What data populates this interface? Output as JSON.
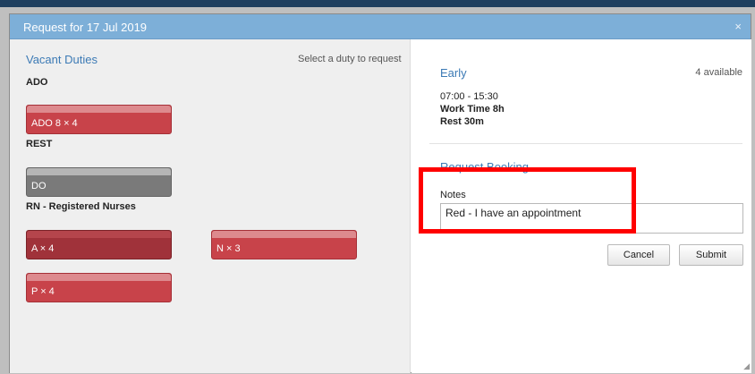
{
  "modal": {
    "title": "Request for 17 Jul 2019",
    "close_label": "×"
  },
  "vacant": {
    "title": "Vacant Duties",
    "hint": "Select a duty to request",
    "groups": [
      {
        "label": "ADO",
        "duties": [
          {
            "label": "ADO 8 × 4",
            "color": "#c8434a"
          }
        ]
      },
      {
        "label": "REST",
        "duties": [
          {
            "label": "DO",
            "color": "#7a7a7a"
          }
        ]
      },
      {
        "label": "RN - Registered Nurses",
        "duties": [
          {
            "label": "A × 4",
            "color": "#a0323a",
            "selected": true
          },
          {
            "label": "N × 3",
            "color": "#c8434a"
          },
          {
            "label": "P × 4",
            "color": "#c8434a"
          }
        ]
      }
    ]
  },
  "detail": {
    "shift_name": "Early",
    "available": "4 available",
    "time": "07:00 - 15:30",
    "work_time": "Work Time 8h",
    "rest": "Rest 30m"
  },
  "booking": {
    "title": "Request Booking",
    "notes_label": "Notes",
    "notes_value": "Red - I have an appointment",
    "cancel_label": "Cancel",
    "submit_label": "Submit"
  },
  "colors": {
    "header": "#7dafd8",
    "accent_text": "#3c7ab5",
    "duty_red": "#c8434a",
    "duty_selected": "#a0323a",
    "duty_grey": "#7a7a7a",
    "highlight": "#ff0000"
  }
}
